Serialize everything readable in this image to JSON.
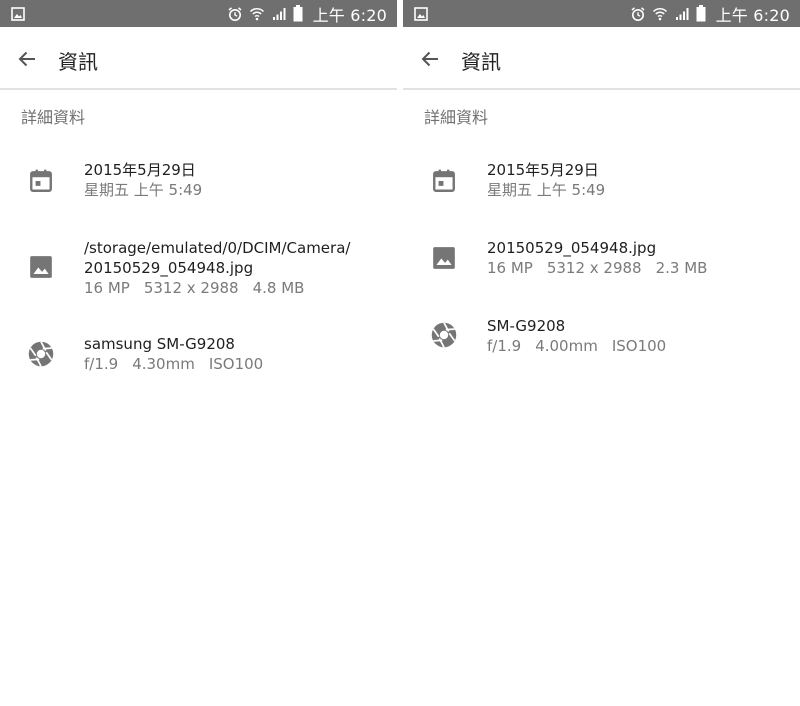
{
  "status_bar": {
    "time": "上午 6:20",
    "left_icon": "gallery-notification-icon",
    "right_icons": [
      "alarm-icon",
      "wifi-icon",
      "signal-icon",
      "battery-icon"
    ]
  },
  "app_bar": {
    "back_icon": "back-arrow-icon",
    "title": "資訊"
  },
  "section": {
    "title": "詳細資料"
  },
  "screens": [
    {
      "date": {
        "icon": "calendar-icon",
        "primary": "2015年5月29日",
        "secondary": "星期五 上午 5:49"
      },
      "file": {
        "icon": "image-icon",
        "primary_lines": [
          "/storage/emulated/0/DCIM/Camera/",
          "20150529_054948.jpg"
        ],
        "megapixels": "16 MP",
        "resolution": "5312 x 2988",
        "size": "4.8 MB"
      },
      "camera": {
        "icon": "aperture-icon",
        "primary": "samsung SM-G9208",
        "aperture": "f/1.9",
        "focal_length": "4.30mm",
        "iso": "ISO100"
      }
    },
    {
      "date": {
        "icon": "calendar-icon",
        "primary": "2015年5月29日",
        "secondary": "星期五 上午 5:49"
      },
      "file": {
        "icon": "image-icon",
        "primary_lines": [
          "20150529_054948.jpg"
        ],
        "megapixels": "16 MP",
        "resolution": "5312 x 2988",
        "size": "2.3 MB"
      },
      "camera": {
        "icon": "aperture-icon",
        "primary": "SM-G9208",
        "aperture": "f/1.9",
        "focal_length": "4.00mm",
        "iso": "ISO100"
      }
    }
  ],
  "colors": {
    "status_bar_bg": "#6f6f6f",
    "icon_gray": "#757575",
    "primary_text": "#1f1f1f",
    "secondary_text": "#7a7a7a",
    "divider": "#e2e2e2"
  }
}
